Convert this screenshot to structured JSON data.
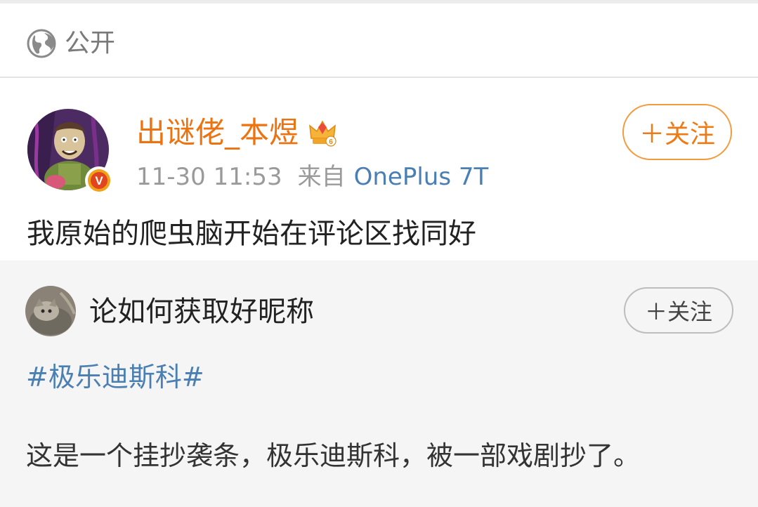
{
  "visibility": {
    "label": "公开",
    "icon": "globe-icon"
  },
  "post": {
    "username": "出谜佬_本煜",
    "time": "11-30 11:53",
    "source_prefix": "来自",
    "device": "OnePlus 7T",
    "follow_label": "＋关注",
    "text": "我原始的爬虫脑开始在评论区找同好",
    "badge_letter": "V",
    "crown_level": "6"
  },
  "repost": {
    "username": "论如何获取好昵称",
    "follow_label": "＋关注",
    "hashtag": "#极乐迪斯科#",
    "text": "这是一个挂抄袭条，极乐迪斯科，被一部戏剧抄了。"
  },
  "colors": {
    "username": "#eb7311",
    "link": "#4a7fb4",
    "meta": "#9a9a9a"
  }
}
